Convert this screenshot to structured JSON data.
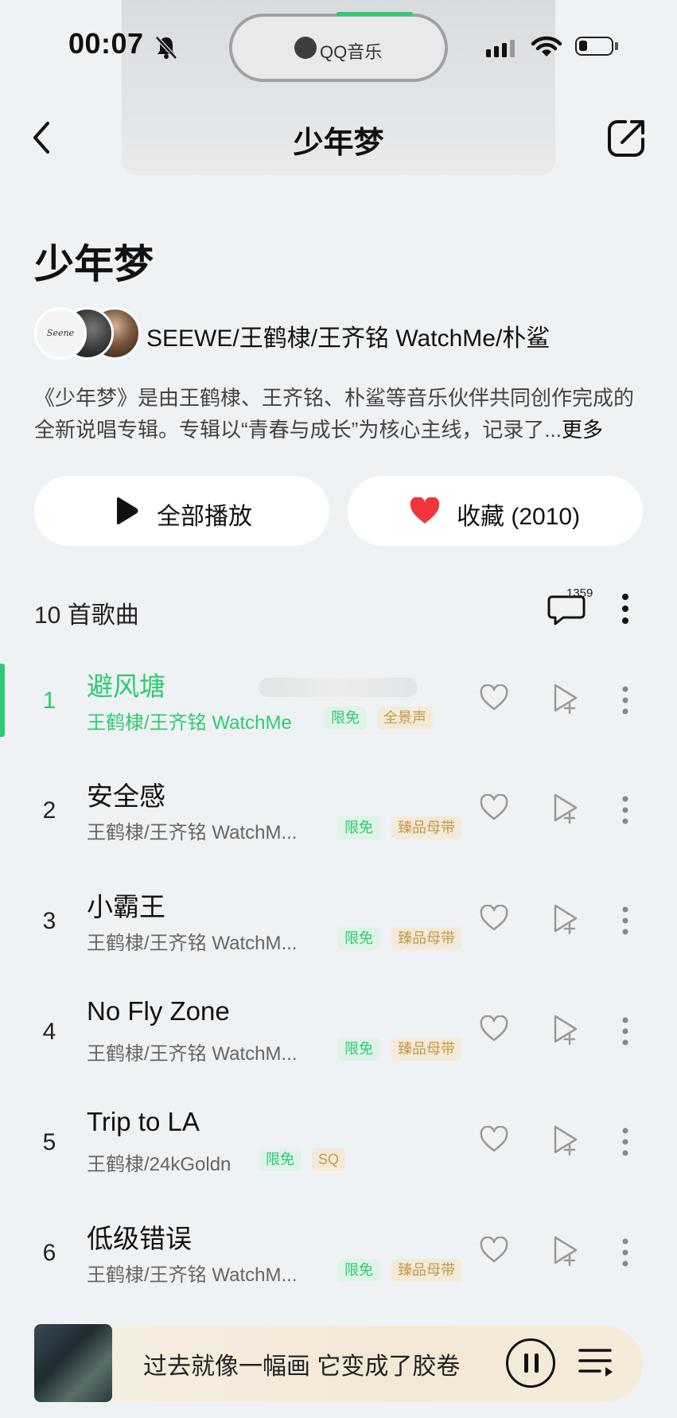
{
  "status_bar": {
    "time": "00:07",
    "island_app": "QQ音乐"
  },
  "nav": {
    "title": "少年梦"
  },
  "album": {
    "title": "少年梦",
    "avatar_text": "Seene",
    "artists": "SEEWE/王鹤棣/王齐铭 WatchMe/朴鲨",
    "description": "《少年梦》是由王鹤棣、王齐铭、朴鲨等音乐伙伴共同创作完成的全新说唱专辑。专辑以“青春与成长”为核心主线，记录了...",
    "more_label": "更多"
  },
  "actions": {
    "play_all_label": "全部播放",
    "favorite_label": "收藏 (2010)"
  },
  "list_header": {
    "count_label": "10 首歌曲",
    "comment_count": "1359"
  },
  "songs": [
    {
      "index": "1",
      "title": "避风塘",
      "artist": "王鹤棣/王齐铭 WatchMe",
      "tags": [
        "限免",
        "全景声"
      ],
      "active": true
    },
    {
      "index": "2",
      "title": "安全感",
      "artist": "王鹤棣/王齐铭 WatchM...",
      "tags": [
        "限免",
        "臻品母带"
      ]
    },
    {
      "index": "3",
      "title": "小霸王",
      "artist": "王鹤棣/王齐铭 WatchM...",
      "tags": [
        "限免",
        "臻品母带"
      ]
    },
    {
      "index": "4",
      "title": "No Fly Zone",
      "artist": "王鹤棣/王齐铭 WatchM...",
      "tags": [
        "限免",
        "臻品母带"
      ]
    },
    {
      "index": "5",
      "title": "Trip to LA",
      "artist": "王鹤棣/24kGoldn",
      "tags": [
        "限免",
        "SQ"
      ]
    },
    {
      "index": "6",
      "title": "低级错误",
      "artist": "王鹤棣/王齐铭 WatchM...",
      "tags": [
        "限免",
        "臻品母带"
      ]
    }
  ],
  "player": {
    "lyric": "过去就像一幅画 它变成了胶卷"
  },
  "icons": {
    "back": "chevron-left-icon",
    "share": "share-icon",
    "play": "play-icon",
    "heart": "heart-icon",
    "comment": "comment-icon",
    "more": "more-vertical-icon",
    "add_to_playlist": "add-to-playlist-icon",
    "pause": "pause-icon",
    "playlist": "playlist-icon"
  },
  "colors": {
    "accent_green": "#2fca71",
    "heart_red": "#f0353d",
    "tag_gold": "#c49a48",
    "background": "#eff2f4"
  }
}
